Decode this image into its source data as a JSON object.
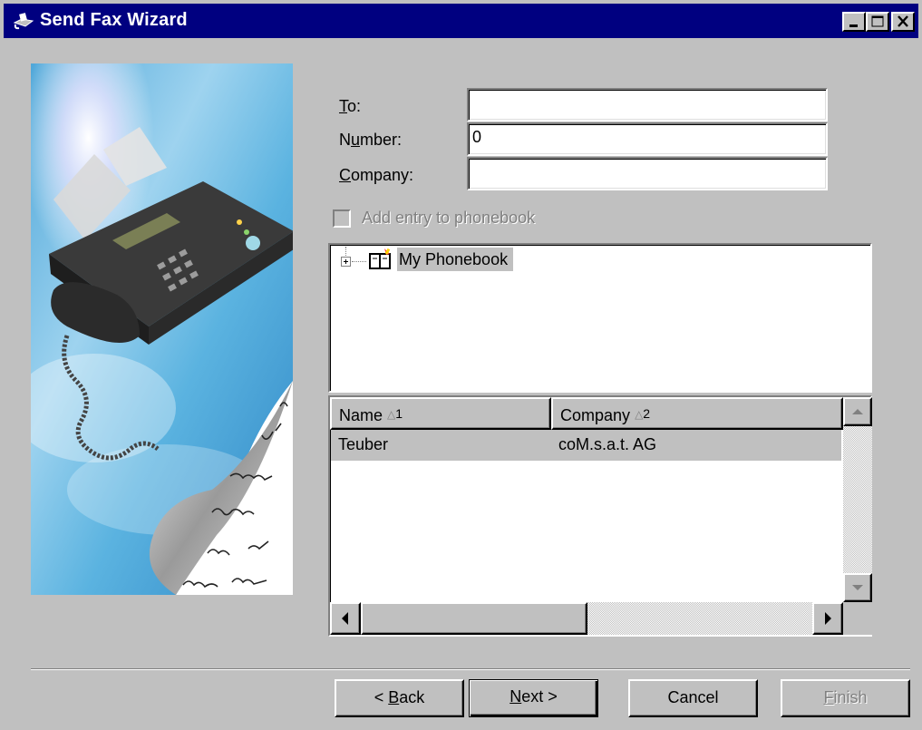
{
  "window": {
    "title": "Send Fax Wizard",
    "controls": [
      "minimize",
      "maximize",
      "close"
    ]
  },
  "form": {
    "to_label_u": "T",
    "to_label_rest": "o:",
    "to_value": "",
    "number_label_a": "N",
    "number_label_u": "u",
    "number_label_rest": "mber:",
    "number_value": "0",
    "company_label_u": "C",
    "company_label_rest": "ompany:",
    "company_value": "",
    "add_entry_label": "Add entry to phonebook",
    "add_entry_checked": false,
    "add_entry_enabled": false
  },
  "tree": {
    "root_label": "My Phonebook",
    "expanded": false
  },
  "list": {
    "columns": [
      {
        "label": "Name",
        "sort_index": "1"
      },
      {
        "label": "Company",
        "sort_index": "2"
      }
    ],
    "rows": [
      {
        "name": "Teuber",
        "company": "coM.s.a.t. AG",
        "selected": true
      }
    ]
  },
  "buttons": {
    "back_pre": "< ",
    "back_u": "B",
    "back_rest": "ack",
    "next_u": "N",
    "next_rest": "ext >",
    "cancel": "Cancel",
    "finish_u": "F",
    "finish_rest": "inish"
  },
  "icons": {
    "app": "fax-app-icon",
    "phonebook": "phonebook-icon"
  },
  "colors": {
    "titlebar": "#000080",
    "face": "#c0c0c0",
    "selection": "#c0c0c0"
  }
}
